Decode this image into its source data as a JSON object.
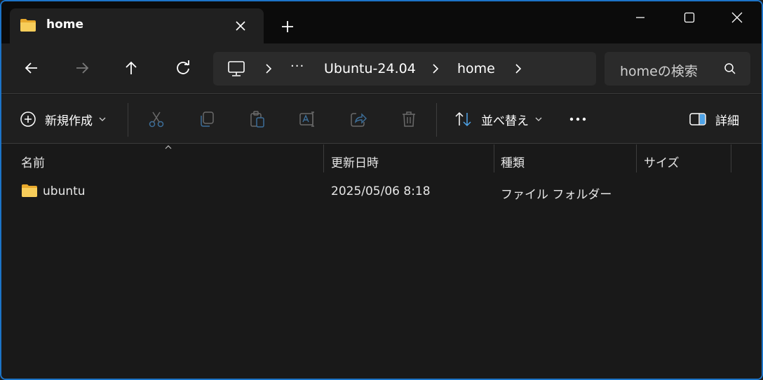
{
  "tab": {
    "title": "home"
  },
  "breadcrumb": {
    "overflow": "···",
    "items": [
      "Ubuntu-24.04",
      "home"
    ]
  },
  "search": {
    "placeholder": "homeの検索"
  },
  "commands": {
    "new_label": "新規作成",
    "sort_label": "並べ替え",
    "details_label": "詳細"
  },
  "columns": {
    "name": "名前",
    "modified": "更新日時",
    "type": "種類",
    "size": "サイズ"
  },
  "rows": [
    {
      "name": "ubuntu",
      "modified": "2025/05/06 8:18",
      "type": "ファイル フォルダー",
      "size": ""
    }
  ],
  "colors": {
    "accent": "#1c74c8",
    "folder": "#f4c245",
    "bg": "#191919"
  }
}
